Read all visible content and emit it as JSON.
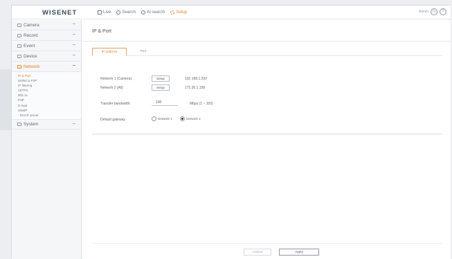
{
  "app": {
    "logo": "WISENET"
  },
  "top_menu": [
    {
      "label": "Live",
      "icon": "monitor-icon",
      "active": false
    },
    {
      "label": "Search",
      "icon": "search-icon",
      "active": false
    },
    {
      "label": "AI search",
      "icon": "ai-search-icon",
      "active": false
    },
    {
      "label": "Setup",
      "icon": "gear-icon",
      "active": true
    }
  ],
  "top_right": {
    "user": "Admin",
    "logout_icon": "power-icon",
    "help_icon": "help-icon",
    "help_glyph": "?"
  },
  "sidebar": {
    "items": [
      {
        "label": "Camera",
        "icon": "camera-icon"
      },
      {
        "label": "Record",
        "icon": "record-icon"
      },
      {
        "label": "Event",
        "icon": "bell-icon"
      },
      {
        "label": "Device",
        "icon": "device-icon"
      },
      {
        "label": "Network",
        "icon": "network-icon"
      }
    ],
    "network_sub": [
      "IP & Port",
      "DDNS & P2P",
      "IP filtering",
      "nSTPS",
      "802.1x",
      "P3P",
      "E-mail",
      "SNMP",
      "· DHCP server"
    ],
    "system": {
      "label": "System",
      "icon": "gear-icon"
    }
  },
  "page": {
    "title": "IP & Port",
    "tabs": [
      "IP address",
      "Port"
    ],
    "network1_label": "Network 1 (Camera)",
    "network2_label": "Network 2 (All)",
    "setup_label": "Setup",
    "network1_ip": "192.168.1.200",
    "network2_ip": "172.30.1.158",
    "bandwidth_label": "Transfer bandwidth",
    "bandwidth_value": "100",
    "bandwidth_unit": "Mbps (1 ~ 100)",
    "gateway_label": "Default gateway",
    "gateway_options": [
      "Network 1",
      "Network 2"
    ],
    "gateway_selected": "Network 2"
  },
  "footer": {
    "cancel": "Cancel",
    "ok": "Apply"
  },
  "colors": {
    "accent": "#e0812f",
    "text": "#5d6875",
    "sidebar_bg": "#f5f6f8"
  }
}
